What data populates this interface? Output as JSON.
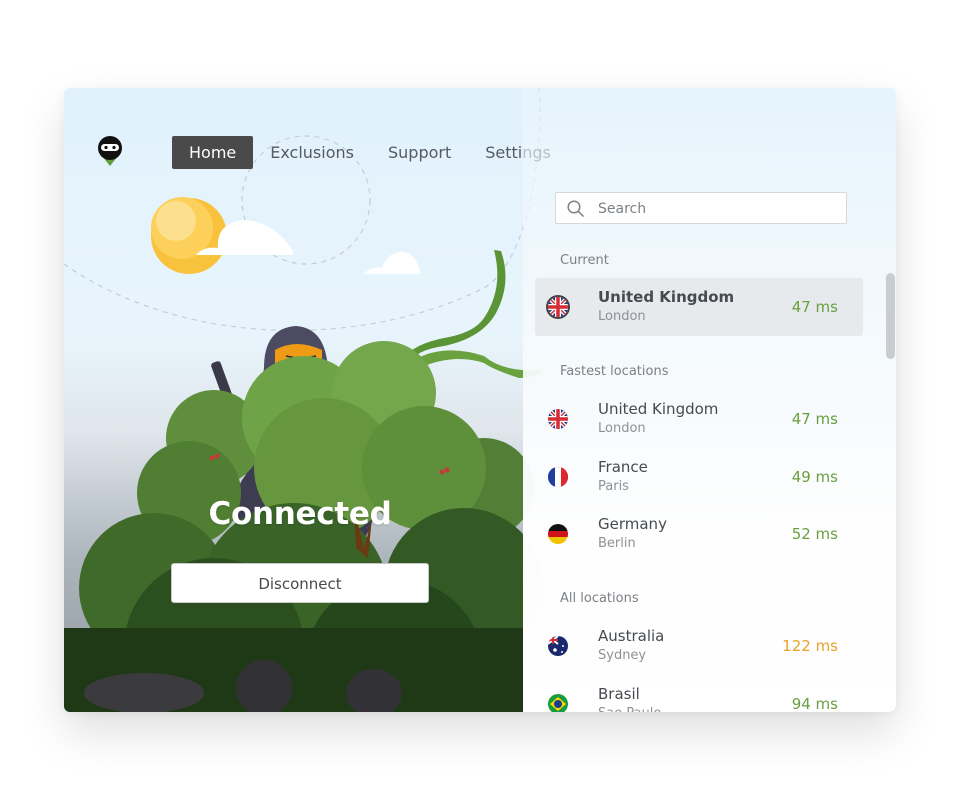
{
  "app": {
    "logo_icon": "ninja-logo-icon"
  },
  "nav": {
    "items": [
      {
        "label": "Home",
        "active": true
      },
      {
        "label": "Exclusions",
        "active": false
      },
      {
        "label": "Support",
        "active": false
      },
      {
        "label": "Settings",
        "active": false
      }
    ]
  },
  "connection": {
    "status": "Connected",
    "action_label": "Disconnect"
  },
  "search": {
    "placeholder": "Search",
    "value": "",
    "icon": "search-icon"
  },
  "sections": {
    "current_label": "Current",
    "fastest_label": "Fastest locations",
    "all_label": "All locations"
  },
  "current": {
    "country": "United Kingdom",
    "city": "London",
    "ping": "47 ms",
    "flag": "uk-flag-icon",
    "ping_color": "#6a9f3f"
  },
  "fastest": [
    {
      "country": "United Kingdom",
      "city": "London",
      "ping": "47 ms",
      "flag": "uk-flag-icon",
      "ping_color": "#6a9f3f"
    },
    {
      "country": "France",
      "city": "Paris",
      "ping": "49 ms",
      "flag": "france-flag-icon",
      "ping_color": "#6a9f3f"
    },
    {
      "country": "Germany",
      "city": "Berlin",
      "ping": "52 ms",
      "flag": "germany-flag-icon",
      "ping_color": "#6a9f3f"
    }
  ],
  "all": [
    {
      "country": "Australia",
      "city": "Sydney",
      "ping": "122 ms",
      "flag": "australia-flag-icon",
      "ping_color": "#e8a227"
    },
    {
      "country": "Brasil",
      "city": "Sao Paulo",
      "ping": "94 ms",
      "flag": "brazil-flag-icon",
      "ping_color": "#6a9f3f"
    }
  ],
  "colors": {
    "accent_green": "#6a9f3f",
    "warning_orange": "#e8a227",
    "nav_active_bg": "#4a4a4a"
  }
}
